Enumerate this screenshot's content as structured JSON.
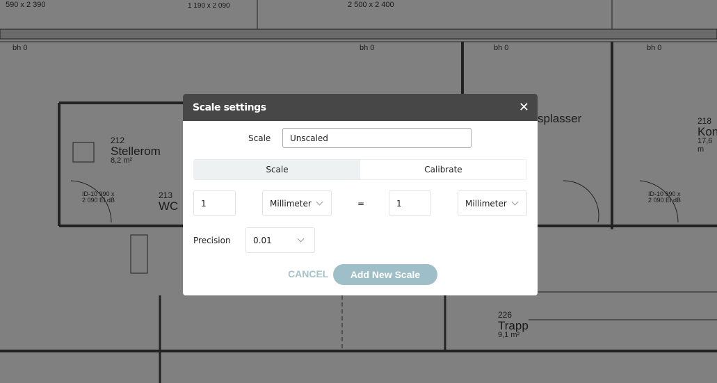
{
  "background": {
    "rooms": [
      {
        "number": "212",
        "name": "Stellerom",
        "area": "8,2 m²"
      },
      {
        "number": "213",
        "name": "WC",
        "area": ""
      },
      {
        "number": "226",
        "name": "Trapp",
        "area": "9,1 m²"
      },
      {
        "number": "218",
        "name": "Kon",
        "area": "17,6 m"
      },
      {
        "number": "",
        "name": "splasser",
        "area": ""
      }
    ],
    "annotations": [
      "bh 0",
      "bh 0",
      "bh 0",
      "bh 0",
      "590 x 2 390",
      "2 500 x 2 400",
      "1 190 x 2 090",
      "ID-10 990 x 2 090 EI dB",
      "ID-10 990 x 2 090 EI dB"
    ]
  },
  "dialog": {
    "title": "Scale settings",
    "close_icon": "close-icon",
    "scale_label": "Scale",
    "scale_value": "Unscaled",
    "tabs": [
      {
        "label": "Scale",
        "active": true
      },
      {
        "label": "Calibrate",
        "active": false
      }
    ],
    "left_value": "1",
    "left_unit": "Millimeter",
    "equals": "=",
    "right_value": "1",
    "right_unit": "Millimeter",
    "precision_label": "Precision",
    "precision_value": "0.01",
    "cancel_label": "CANCEL",
    "add_label": "Add New Scale",
    "accent": "#9fbfc8"
  }
}
